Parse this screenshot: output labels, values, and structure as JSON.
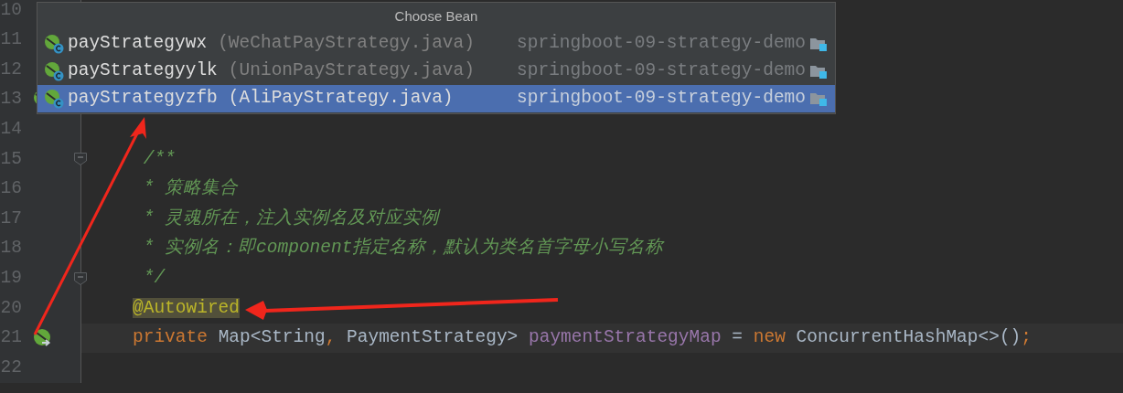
{
  "editor": {
    "lines": [
      {
        "number": "10"
      },
      {
        "number": "11"
      },
      {
        "number": "12"
      },
      {
        "number": "13",
        "bean_marker": true
      },
      {
        "number": "14"
      },
      {
        "number": "15",
        "fold": true,
        "tokens": [
          {
            "kind": "comment",
            "text": " /**"
          }
        ]
      },
      {
        "number": "16",
        "tokens": [
          {
            "kind": "comment",
            "text": " * 策略集合"
          }
        ]
      },
      {
        "number": "17",
        "tokens": [
          {
            "kind": "comment",
            "text": " * 灵魂所在，注入实例名及对应实例"
          }
        ]
      },
      {
        "number": "18",
        "tokens": [
          {
            "kind": "comment",
            "text": " * 实例名：即component指定名称，默认为类名首字母小写名称"
          }
        ]
      },
      {
        "number": "19",
        "fold": true,
        "tokens": [
          {
            "kind": "comment",
            "text": " */"
          }
        ]
      },
      {
        "number": "20",
        "tokens": [
          {
            "kind": "annotation",
            "text": "@Autowired"
          }
        ]
      },
      {
        "number": "21",
        "autowired_marker": true,
        "current": true,
        "tokens": [
          {
            "kind": "keyword",
            "text": "private "
          },
          {
            "kind": "plain",
            "text": "Map<String"
          },
          {
            "kind": "keyword",
            "text": ", "
          },
          {
            "kind": "plain",
            "text": "PaymentStrategy> "
          },
          {
            "kind": "field",
            "text": "paymentStrategyMap"
          },
          {
            "kind": "plain",
            "text": " = "
          },
          {
            "kind": "keyword",
            "text": "new "
          },
          {
            "kind": "plain",
            "text": "ConcurrentHashMap<>()"
          },
          {
            "kind": "keyword",
            "text": ";"
          }
        ]
      },
      {
        "number": "22"
      }
    ]
  },
  "popup": {
    "title": "Choose Bean",
    "items": [
      {
        "name": "payStrategywx",
        "file": "(WeChatPayStrategy.java)",
        "module": "springboot-09-strategy-demo",
        "selected": false
      },
      {
        "name": "payStrategyylk",
        "file": "(UnionPayStrategy.java)",
        "module": "springboot-09-strategy-demo",
        "selected": false
      },
      {
        "name": "payStrategyzfb",
        "file": "(AliPayStrategy.java)",
        "module": "springboot-09-strategy-demo",
        "selected": true
      }
    ]
  }
}
